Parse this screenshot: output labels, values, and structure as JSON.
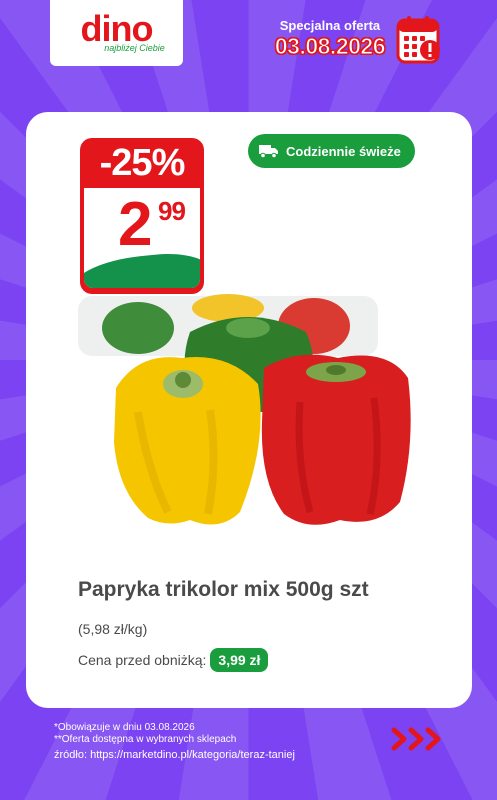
{
  "brand": {
    "logo_text": "dino",
    "tagline": "najbliżej Ciebie",
    "red": "#e3161c",
    "green": "#1a9d3c"
  },
  "offer": {
    "label": "Specjalna oferta",
    "date": "03.08.2026",
    "icon": "calendar-alert-icon"
  },
  "product": {
    "discount": "-25%",
    "price_main": "2",
    "price_cents": "99",
    "badge_label": "Codziennie świeże",
    "badge_icon": "delivery-truck-icon",
    "name": "Papryka trikolor mix 500g szt",
    "unit_price": "(5,98 zł/kg)",
    "previous_price_label": "Cena przed obniżką:",
    "previous_price": "3,99 zł"
  },
  "footer": {
    "note1": "*Obowiązuje w dniu 03.08.2026",
    "note2": "**Oferta dostępna w wybranych sklepach",
    "source": "źródło: https://marketdino.pl/kategoria/teraz-taniej",
    "next_icon": "triple-chevron-right-icon"
  }
}
